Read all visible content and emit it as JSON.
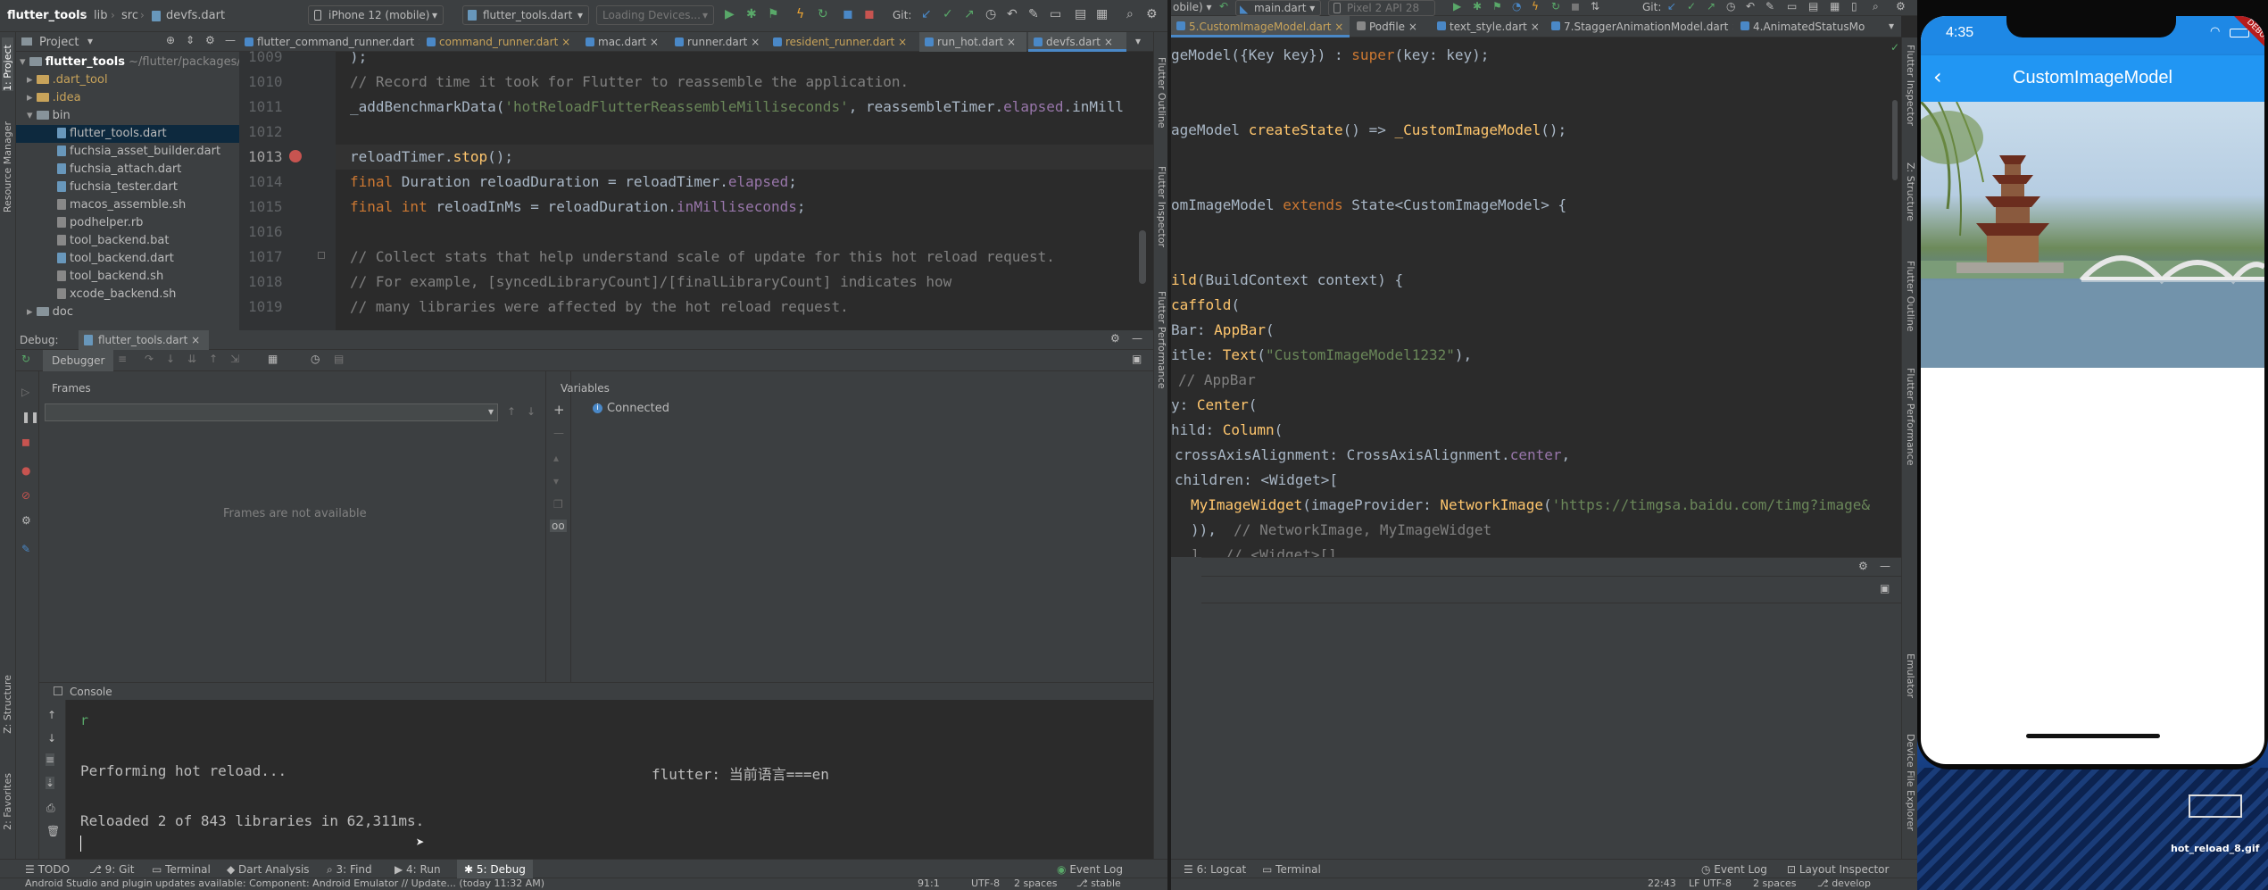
{
  "nav_bar": {
    "crumbs": [
      "flutter_tools",
      "lib",
      "src",
      "devfs.dart"
    ],
    "device_selector": "iPhone 12 (mobile)",
    "run_config": "flutter_tools.dart",
    "loading_devices": "Loading Devices...",
    "git_label": "Git:"
  },
  "right_nav": {
    "target_prefix": "obile)",
    "main_config": "main.dart",
    "emulator": "Pixel 2 API 28",
    "git_label": "Git:"
  },
  "project_panel": {
    "title": "Project",
    "root_name": "flutter_tools",
    "root_path": "~/flutter/packages/fl",
    "items": [
      {
        "label": ".dart_tool",
        "type": "folder"
      },
      {
        "label": ".idea",
        "type": "folder"
      },
      {
        "label": "bin",
        "type": "folder"
      },
      {
        "label": "flutter_tools.dart",
        "type": "file"
      },
      {
        "label": "fuchsia_asset_builder.dart",
        "type": "file"
      },
      {
        "label": "fuchsia_attach.dart",
        "type": "file"
      },
      {
        "label": "fuchsia_tester.dart",
        "type": "file"
      },
      {
        "label": "macos_assemble.sh",
        "type": "file"
      },
      {
        "label": "podhelper.rb",
        "type": "file"
      },
      {
        "label": "tool_backend.bat",
        "type": "file"
      },
      {
        "label": "tool_backend.dart",
        "type": "file"
      },
      {
        "label": "tool_backend.sh",
        "type": "file"
      },
      {
        "label": "xcode_backend.sh",
        "type": "file"
      },
      {
        "label": "doc",
        "type": "folder"
      }
    ]
  },
  "left_editor": {
    "tabs": [
      "flutter_command_runner.dart",
      "command_runner.dart",
      "mac.dart",
      "runner.dart",
      "resident_runner.dart",
      "run_hot.dart",
      "devfs.dart"
    ],
    "line_numbers": [
      "1009",
      "1010",
      "1011",
      "1012",
      "1013",
      "1014",
      "1015",
      "1016",
      "1017",
      "1018",
      "1019"
    ],
    "lines": {
      "l1009": ");",
      "l1010": "// Record time it took for Flutter to reassemble the application.",
      "l1011a": "_addBenchmarkData(",
      "l1011b": "'hotReloadFlutterReassembleMilliseconds'",
      "l1011c": ", reassembleTimer.",
      "l1011d": "elapsed",
      "l1011e": ".inMill",
      "l1013a": "reloadTimer.",
      "l1013b": "stop",
      "l1013c": "();",
      "l1014a": "final ",
      "l1014b": "Duration reloadDuration = reloadTimer.",
      "l1014c": "elapsed",
      "l1014d": ";",
      "l1015a": "final int ",
      "l1015b": "reloadInMs = reloadDuration.",
      "l1015c": "inMilliseconds",
      "l1015d": ";",
      "l1017": "// Collect stats that help understand scale of update for this hot reload request.",
      "l1018": "// For example, [syncedLibraryCount]/[finalLibraryCount] indicates how",
      "l1019": "// many libraries were affected by the hot reload request."
    }
  },
  "right_editor": {
    "tabs": [
      "5.CustomImageModel.dart",
      "Podfile",
      "text_style.dart",
      "7.StaggerAnimationModel.dart",
      "4.AnimatedStatusMo"
    ],
    "lines": {
      "r1a": "geModel({Key key}) : ",
      "r1b": "super",
      "r1c": "(key: key);",
      "r2a": "ageModel ",
      "r2b": "createState",
      "r2c": "() => ",
      "r2d": "_CustomImageModel",
      "r2e": "();",
      "r3a": "omImageModel ",
      "r3b": "extends ",
      "r3c": "State<CustomImageModel> {",
      "r4a": "ild",
      "r4b": "(BuildContext context) {",
      "r5a": "caffold",
      "r5b": "(",
      "r6a": "Bar: ",
      "r6b": "AppBar",
      "r6c": "(",
      "r7a": "itle: ",
      "r7b": "Text",
      "r7c": "(",
      "r7d": "\"CustomImageModel1232\"",
      "r7e": "),",
      "r8": "// AppBar",
      "r9a": "y: ",
      "r9b": "Center",
      "r9c": "(",
      "r10a": "hild: ",
      "r10b": "Column",
      "r10c": "(",
      "r11a": "crossAxisAlignment: CrossAxisAlignment.",
      "r11b": "center",
      "r11c": ",",
      "r12a": "children: <Widget>[",
      "r13a": "MyImageWidget",
      "r13b": "(imageProvider: ",
      "r13c": "NetworkImage",
      "r13d": "(",
      "r13e": "'https://timgsa.baidu.com/timg?image&",
      "r14a": ")),  ",
      "r14b": "// NetworkImage, MyImageWidget",
      "r15": "],  // <Widget>[]"
    }
  },
  "debug_panel": {
    "label": "Debug:",
    "session_tab": "flutter_tools.dart",
    "debugger_tab": "Debugger",
    "frames_header": "Frames",
    "frames_empty": "Frames are not available",
    "variables_header": "Variables",
    "connected": "Connected",
    "console_tab": "Console"
  },
  "console": {
    "prompt": "r",
    "line1": "Performing hot reload...",
    "line1_right": "flutter: 当前语言===en",
    "line2": "Reloaded 2 of 843 libraries in 62,311ms."
  },
  "bottom_tools_left": [
    {
      "label": "TODO"
    },
    {
      "label": "9: Git"
    },
    {
      "label": "Terminal"
    },
    {
      "label": "Dart Analysis"
    },
    {
      "label": "3: Find"
    },
    {
      "label": "4: Run"
    },
    {
      "label": "5: Debug"
    }
  ],
  "event_log_left": "Event Log",
  "bottom_tools_right": {
    "logcat": "6: Logcat",
    "terminal": "Terminal",
    "event_log": "Event Log",
    "layout_inspector": "Layout Inspector"
  },
  "status_left": {
    "message": "Android Studio and plugin updates available: Component: Android Emulator // Update... (today 11:32 AM)",
    "position": "91:1",
    "encoding": "UTF-8",
    "indent": "2 spaces",
    "branch": "stable"
  },
  "status_right": {
    "position": "22:43",
    "encoding": "LF  UTF-8",
    "indent": "2 spaces",
    "branch": "develop"
  },
  "left_side_tabs": [
    "1: Project",
    "Resource Manager",
    "Z: Structure",
    "2: Favorites"
  ],
  "right_side_tabs_left": [
    "Flutter Outline",
    "Flutter Inspector",
    "Flutter Performance"
  ],
  "right_side_tabs_right": [
    "Flutter Inspector",
    "Z: Structure",
    "Flutter Outline",
    "Flutter Performance",
    "Emulator",
    "Device File Explorer"
  ],
  "phone": {
    "time": "4:35",
    "app_title": "CustomImageModel",
    "debug_ribbon": "DEBUG",
    "overlay_file": "hot_reload_8.gif"
  },
  "colors": {
    "phone_appbar": "#2196f3",
    "accent_blue": "#4a88c7"
  }
}
